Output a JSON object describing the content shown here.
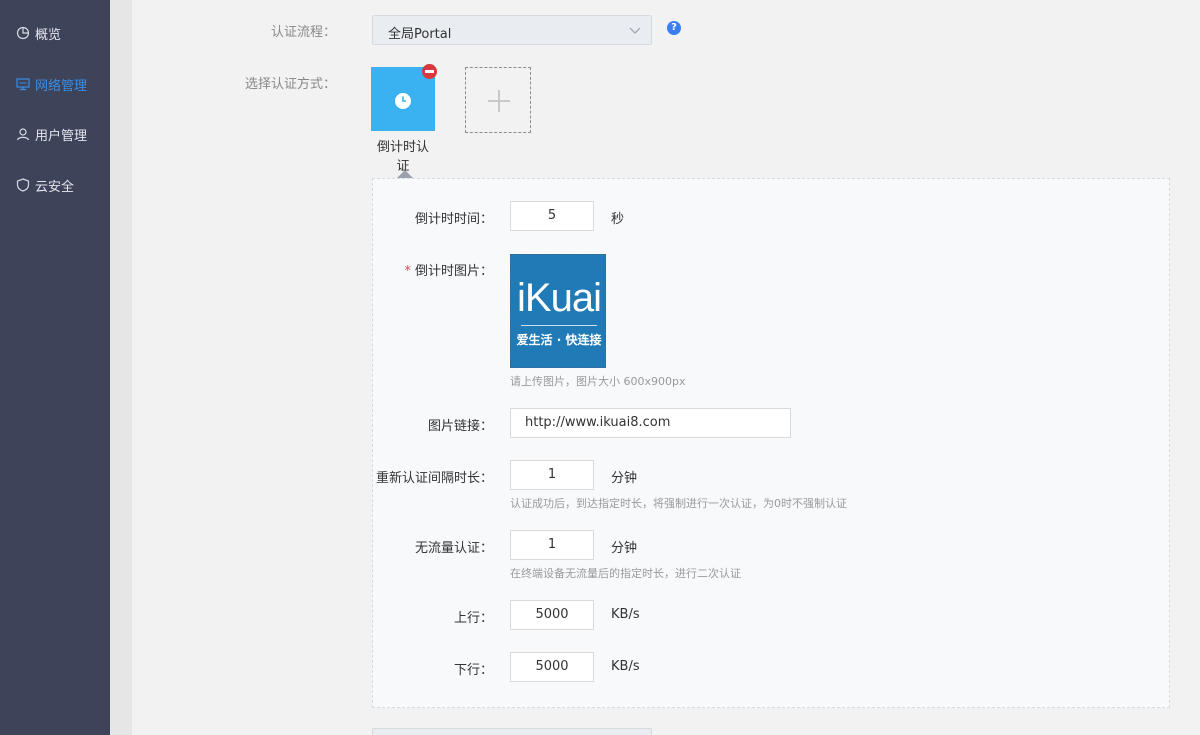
{
  "sidebar": {
    "items": [
      {
        "label": "概览",
        "icon": "pie-chart-icon"
      },
      {
        "label": "网络管理",
        "icon": "monitor-icon",
        "active": true
      },
      {
        "label": "用户管理",
        "icon": "user-icon"
      },
      {
        "label": "云安全",
        "icon": "shield-icon"
      }
    ]
  },
  "form": {
    "flow_label": "认证流程：",
    "flow_value": "全局Portal",
    "help_glyph": "?",
    "method_label": "选择认证方式：",
    "method_selected": "倒计时认证"
  },
  "countdown": {
    "time_label": "倒计时时间：",
    "time_value": "5",
    "time_unit": "秒",
    "image_required_mark": "*",
    "image_label": "倒计时图片：",
    "image_brand": "iKuai",
    "image_slogan": "爱生活 · 快连接",
    "image_hint": "请上传图片，图片大小 600x900px",
    "link_label": "图片链接：",
    "link_value": "http://www.ikuai8.com",
    "reauth_label": "重新认证间隔时长：",
    "reauth_value": "1",
    "reauth_unit": "分钟",
    "reauth_hint": "认证成功后，到达指定时长，将强制进行一次认证，为0时不强制认证",
    "idle_label": "无流量认证：",
    "idle_value": "1",
    "idle_unit": "分钟",
    "idle_hint": "在终端设备无流量后的指定时长，进行二次认证",
    "up_label": "上行：",
    "up_value": "5000",
    "up_unit": "KB/s",
    "down_label": "下行：",
    "down_value": "5000",
    "down_unit": "KB/s"
  },
  "colors": {
    "sidebar_bg": "#3d4359",
    "active": "#3a8ee6",
    "tile": "#3ab1f1",
    "remove": "#d9363e",
    "brand_bg": "#1f7ab5"
  }
}
